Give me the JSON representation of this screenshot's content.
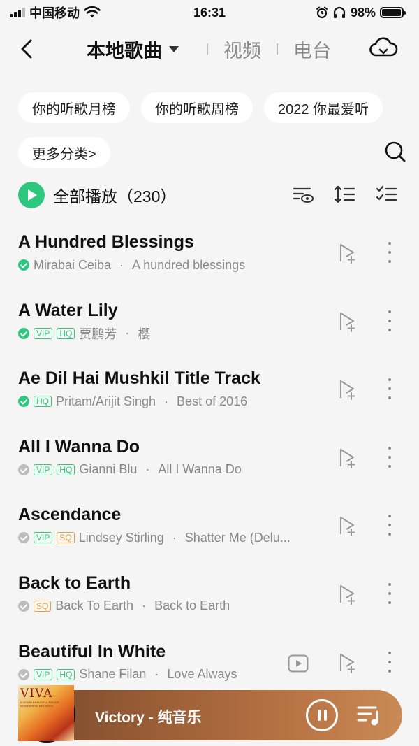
{
  "status_bar": {
    "carrier": "中国移动",
    "time": "16:31",
    "battery_text": "98%",
    "battery_level": 0.98
  },
  "header": {
    "tabs": [
      {
        "label": "本地歌曲",
        "active": true
      },
      {
        "label": "视频",
        "active": false
      },
      {
        "label": "电台",
        "active": false
      }
    ]
  },
  "chips": [
    "你的听歌月榜",
    "你的听歌周榜",
    "2022 你最爱听",
    "更多分类>"
  ],
  "play_all": {
    "label": "全部播放",
    "count": "（230）"
  },
  "songs": [
    {
      "title": "A Hundred Blessings",
      "check": "green",
      "badges": [],
      "artist": "Mirabai Ceiba",
      "album": "A hundred blessings",
      "has_mv": false
    },
    {
      "title": "A Water Lily",
      "check": "green",
      "badges": [
        "VIP",
        "HQ"
      ],
      "artist": "贾鹏芳",
      "album": "樱",
      "has_mv": false
    },
    {
      "title": "Ae Dil Hai Mushkil Title Track",
      "check": "green",
      "badges": [
        "HQ"
      ],
      "artist": "Pritam/Arijit Singh",
      "album": "Best of 2016",
      "has_mv": false
    },
    {
      "title": "All I Wanna Do",
      "check": "gray",
      "badges": [
        "VIP",
        "HQ"
      ],
      "artist": "Gianni Blu",
      "album": "All I Wanna Do",
      "has_mv": false
    },
    {
      "title": "Ascendance",
      "check": "gray",
      "badges": [
        "VIP",
        "SQ"
      ],
      "artist": "Lindsey Stirling",
      "album": "Shatter Me (Delu...",
      "has_mv": false
    },
    {
      "title": "Back to Earth",
      "check": "gray",
      "badges": [
        "SQ"
      ],
      "artist": "Back To Earth",
      "album": "Back to Earth",
      "has_mv": false
    },
    {
      "title": "Beautiful In White",
      "check": "gray",
      "badges": [
        "VIP",
        "HQ"
      ],
      "artist": "Shane Filan",
      "album": "Love Always",
      "has_mv": true
    }
  ],
  "meta_separator": "·",
  "player": {
    "now_playing": "Victory - 纯音乐",
    "cover_text": "VIVA",
    "cover_subtext": "A VIOLIN BEAUTIFUL PIECES WONDERFUL MELODIES"
  },
  "colors": {
    "accent": "#2ec77e",
    "sq_badge": "#e6a23c",
    "player_gradient": [
      "#7a4a2e",
      "#c98a55"
    ]
  }
}
